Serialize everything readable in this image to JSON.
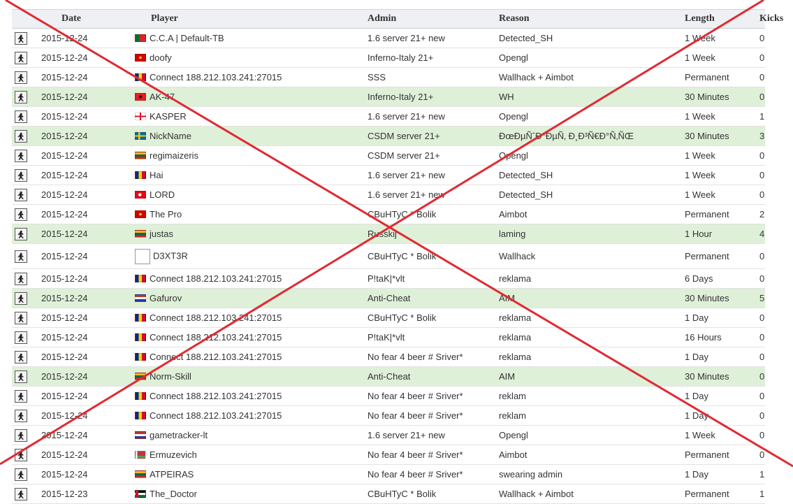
{
  "columns": [
    "Date",
    "Player",
    "Admin",
    "Reason",
    "Length",
    "Kicks"
  ],
  "game_icon": "counter-strike-icon",
  "rows": [
    {
      "date": "2015-12-24",
      "player": "C.C.A | Default-TB",
      "flag": "pt",
      "admin": "1.6 server 21+ new",
      "reason": "Detected_SH",
      "length": "1 Week",
      "kicks": "0",
      "hl": false
    },
    {
      "date": "2015-12-24",
      "player": "doofy",
      "flag": "mk",
      "admin": "Inferno-Italy 21+",
      "reason": "Opengl",
      "length": "1 Week",
      "kicks": "0",
      "hl": false
    },
    {
      "date": "2015-12-24",
      "player": "Connect 188.212.103.241:27015",
      "flag": "ro",
      "admin": "SSS",
      "reason": "Wallhack + Aimbot",
      "length": "Permanent",
      "kicks": "0",
      "hl": false
    },
    {
      "date": "2015-12-24",
      "player": "AK-47",
      "flag": "al",
      "admin": "Inferno-Italy 21+",
      "reason": "WH",
      "length": "30 Minutes",
      "kicks": "0",
      "hl": true
    },
    {
      "date": "2015-12-24",
      "player": "KASPER",
      "flag": "ge",
      "admin": "1.6 server 21+ new",
      "reason": "Opengl",
      "length": "1 Week",
      "kicks": "1",
      "hl": false
    },
    {
      "date": "2015-12-24",
      "player": "NickName",
      "flag": "se",
      "admin": "CSDM server 21+",
      "reason": "ÐœÐµÑˆÐ°ÐµÑ‚ Ð¸Ð³Ñ€Ð°Ñ‚ÑŒ",
      "length": "30 Minutes",
      "kicks": "3",
      "hl": true
    },
    {
      "date": "2015-12-24",
      "player": "regimaizeris",
      "flag": "lt",
      "admin": "CSDM server 21+",
      "reason": "Opengl",
      "length": "1 Week",
      "kicks": "0",
      "hl": false
    },
    {
      "date": "2015-12-24",
      "player": "Hai",
      "flag": "ro",
      "admin": "1.6 server 21+ new",
      "reason": "Detected_SH",
      "length": "1 Week",
      "kicks": "0",
      "hl": false
    },
    {
      "date": "2015-12-24",
      "player": "LORD",
      "flag": "tr",
      "admin": "1.6 server 21+ new",
      "reason": "Detected_SH",
      "length": "1 Week",
      "kicks": "0",
      "hl": false
    },
    {
      "date": "2015-12-24",
      "player": "The Pro",
      "flag": "mk",
      "admin": "CBuHTyC * Bolik",
      "reason": "Aimbot",
      "length": "Permanent",
      "kicks": "2",
      "hl": false
    },
    {
      "date": "2015-12-24",
      "player": "justas",
      "flag": "lt",
      "admin": "Russkij",
      "reason": "laming",
      "length": "1 Hour",
      "kicks": "4",
      "hl": true
    },
    {
      "date": "2015-12-24",
      "player": "D3XT3R",
      "flag": "broken",
      "admin": "CBuHTyC * Bolik",
      "reason": "Wallhack",
      "length": "Permanent",
      "kicks": "0",
      "hl": false
    },
    {
      "date": "2015-12-24",
      "player": "Connect 188.212.103.241:27015",
      "flag": "ro",
      "admin": "P!taK|*vlt",
      "reason": "reklama",
      "length": "6 Days",
      "kicks": "0",
      "hl": false
    },
    {
      "date": "2015-12-24",
      "player": "Gafurov",
      "flag": "tj",
      "admin": "Anti-Cheat",
      "reason": "AIM",
      "length": "30 Minutes",
      "kicks": "5",
      "hl": true
    },
    {
      "date": "2015-12-24",
      "player": "Connect 188.212.103.241:27015",
      "flag": "ro",
      "admin": "CBuHTyC * Bolik",
      "reason": "reklama",
      "length": "1 Day",
      "kicks": "0",
      "hl": false
    },
    {
      "date": "2015-12-24",
      "player": "Connect 188.212.103.241:27015",
      "flag": "ro",
      "admin": "P!taK|*vlt",
      "reason": "reklama",
      "length": "16 Hours",
      "kicks": "0",
      "hl": false
    },
    {
      "date": "2015-12-24",
      "player": "Connect 188.212.103.241:27015",
      "flag": "ro",
      "admin": "No fear 4 beer # Sriver*",
      "reason": "reklama",
      "length": "1 Day",
      "kicks": "0",
      "hl": false
    },
    {
      "date": "2015-12-24",
      "player": "Norm-Skill",
      "flag": "lt",
      "admin": "Anti-Cheat",
      "reason": "AIM",
      "length": "30 Minutes",
      "kicks": "0",
      "hl": true
    },
    {
      "date": "2015-12-24",
      "player": "Connect 188.212.103.241:27015",
      "flag": "ro",
      "admin": "No fear 4 beer # Sriver*",
      "reason": "reklam",
      "length": "1 Day",
      "kicks": "0",
      "hl": false
    },
    {
      "date": "2015-12-24",
      "player": "Connect 188.212.103.241:27015",
      "flag": "ro",
      "admin": "No fear 4 beer # Sriver*",
      "reason": "reklam",
      "length": "1 Day",
      "kicks": "0",
      "hl": false
    },
    {
      "date": "2015-12-24",
      "player": "gametracker-lt",
      "flag": "tj",
      "admin": "1.6 server 21+ new",
      "reason": "Opengl",
      "length": "1 Week",
      "kicks": "0",
      "hl": false
    },
    {
      "date": "2015-12-24",
      "player": "Ermuzevich",
      "flag": "by",
      "admin": "No fear 4 beer # Sriver*",
      "reason": "Aimbot",
      "length": "Permanent",
      "kicks": "0",
      "hl": false
    },
    {
      "date": "2015-12-24",
      "player": "ATPEIRAS",
      "flag": "lt",
      "admin": "No fear 4 beer # Sriver*",
      "reason": "swearing admin",
      "length": "1 Day",
      "kicks": "1",
      "hl": false
    },
    {
      "date": "2015-12-23",
      "player": "The_Doctor",
      "flag": "jo",
      "admin": "CBuHTyC * Bolik",
      "reason": "Wallhack + Aimbot",
      "length": "Permanent",
      "kicks": "1",
      "hl": false
    }
  ],
  "overlay": {
    "type": "red-cross",
    "color": "#e02a33"
  }
}
